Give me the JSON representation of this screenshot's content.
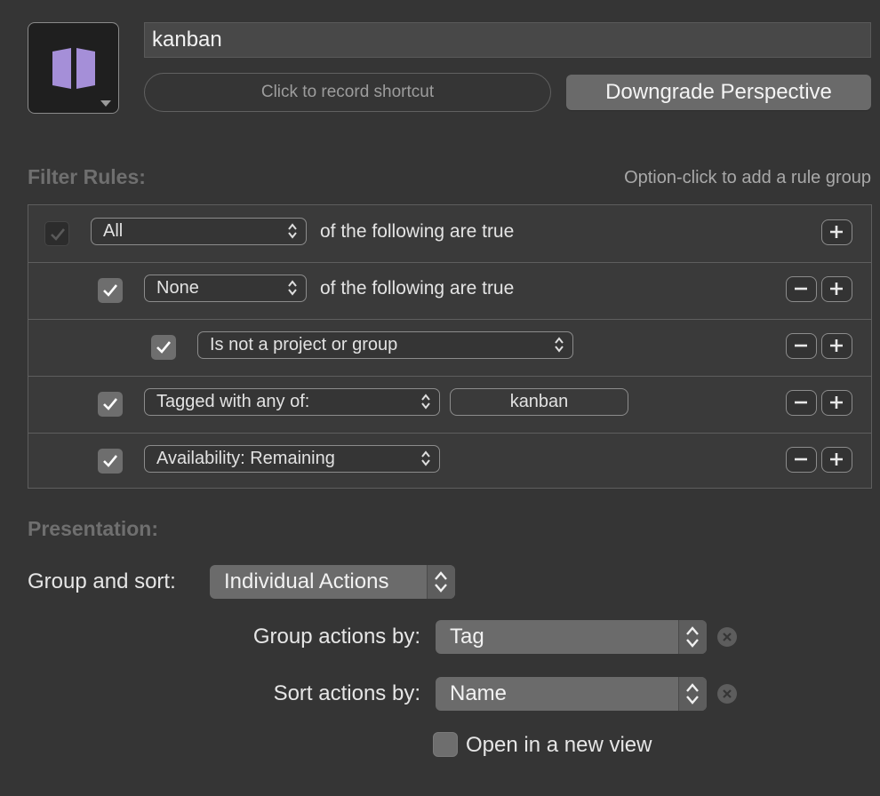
{
  "header": {
    "name_value": "kanban",
    "shortcut_placeholder": "Click to record shortcut",
    "downgrade_label": "Downgrade Perspective",
    "icon_color": "#a58fd8"
  },
  "filter_rules": {
    "title": "Filter Rules:",
    "hint": "Option-click to add a rule group",
    "rows": [
      {
        "checked": true,
        "selector": "All",
        "text": "of the following are true"
      },
      {
        "checked": true,
        "selector": "None",
        "text": "of the following are true"
      },
      {
        "checked": true,
        "selector": "Is not a project or group"
      },
      {
        "checked": true,
        "selector": "Tagged with any of:",
        "token": "kanban"
      },
      {
        "checked": true,
        "selector": "Availability: Remaining"
      }
    ]
  },
  "presentation": {
    "title": "Presentation:",
    "group_sort_label": "Group and sort:",
    "group_sort_value": "Individual Actions",
    "group_by_label": "Group actions by:",
    "group_by_value": "Tag",
    "sort_by_label": "Sort actions by:",
    "sort_by_value": "Name",
    "new_view_label": "Open in a new view",
    "new_view_checked": false
  }
}
